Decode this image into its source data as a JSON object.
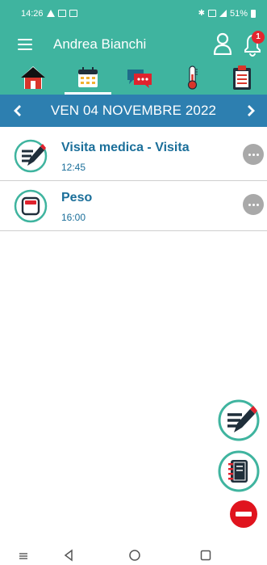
{
  "status_bar": {
    "time": "14:26",
    "battery": "51%",
    "color": "#3fb49f"
  },
  "app_bar": {
    "user_name": "Andrea Bianchi",
    "notification_count": "1",
    "accent": "#3fb49f",
    "tabs": [
      {
        "name": "home",
        "icon": "home-icon"
      },
      {
        "name": "calendar",
        "icon": "calendar-icon",
        "selected": true
      },
      {
        "name": "messages",
        "icon": "chat-icon"
      },
      {
        "name": "measurements",
        "icon": "thermometer-icon"
      },
      {
        "name": "clipboard",
        "icon": "clipboard-icon"
      }
    ]
  },
  "date_bar": {
    "label": "VEN 04 NOVEMBRE 2022",
    "color": "#2d7fb0"
  },
  "events": [
    {
      "title": "Visita medica - Visita",
      "time": "12:45",
      "icon": "pen-note-icon"
    },
    {
      "title": "Peso",
      "time": "16:00",
      "icon": "scale-icon"
    }
  ],
  "fabs": [
    {
      "name": "add-note",
      "icon": "pen-note-icon"
    },
    {
      "name": "diary",
      "icon": "notebook-icon"
    },
    {
      "name": "close",
      "icon": "minus-icon",
      "color": "#e0141e"
    }
  ]
}
